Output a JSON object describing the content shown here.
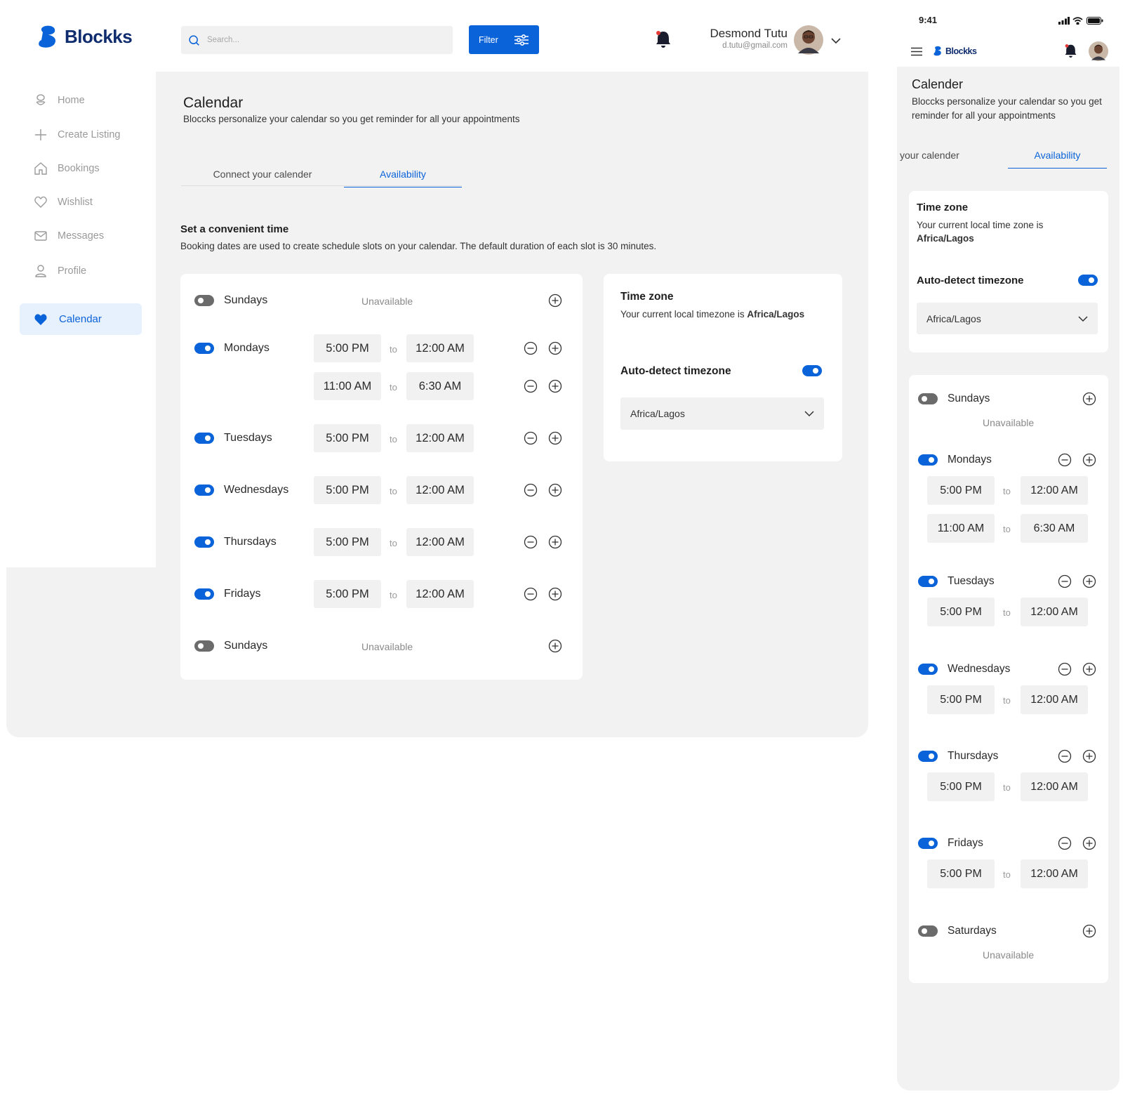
{
  "brand": {
    "name": "Blockks",
    "accent": "#0a63d8",
    "logo_color": "#0f2d6e"
  },
  "sidebar": {
    "items": [
      {
        "label": "Home",
        "icon": "home-icon"
      },
      {
        "label": "Create Listing",
        "icon": "plus-icon"
      },
      {
        "label": "Bookings",
        "icon": "house-icon"
      },
      {
        "label": "Wishlist",
        "icon": "heart-outline-icon"
      },
      {
        "label": "Messages",
        "icon": "mail-icon"
      },
      {
        "label": "Profile",
        "icon": "user-icon"
      },
      {
        "label": "Calendar",
        "icon": "heart-filled-icon",
        "active": true
      }
    ]
  },
  "header": {
    "search_placeholder": "Search...",
    "filter_label": "Filter",
    "user_name": "Desmond Tutu",
    "user_email": "d.tutu@gmail.com"
  },
  "page": {
    "title": "Calendar",
    "subtitle": "Bloccks personalize your calendar so you get reminder for all your appointments",
    "tabs": [
      "Connect your calender",
      "Availability"
    ],
    "active_tab": "Availability",
    "section_title": "Set a convenient time",
    "section_desc": "Booking dates are used to create schedule slots on your calendar. The default duration of each slot is 30 minutes."
  },
  "schedule": {
    "to_label": "to",
    "unavailable_label": "Unavailable",
    "days": [
      {
        "name": "Sundays",
        "enabled": false,
        "slots": []
      },
      {
        "name": "Mondays",
        "enabled": true,
        "slots": [
          [
            "5:00 PM",
            "12:00 AM"
          ],
          [
            "11:00 AM",
            "6:30 AM"
          ]
        ]
      },
      {
        "name": "Tuesdays",
        "enabled": true,
        "slots": [
          [
            "5:00 PM",
            "12:00 AM"
          ]
        ]
      },
      {
        "name": "Wednesdays",
        "enabled": true,
        "slots": [
          [
            "5:00 PM",
            "12:00 AM"
          ]
        ]
      },
      {
        "name": "Thursdays",
        "enabled": true,
        "slots": [
          [
            "5:00 PM",
            "12:00 AM"
          ]
        ]
      },
      {
        "name": "Fridays",
        "enabled": true,
        "slots": [
          [
            "5:00 PM",
            "12:00 AM"
          ]
        ]
      },
      {
        "name": "Sundays",
        "enabled": false,
        "slots": []
      }
    ]
  },
  "timezone": {
    "title": "Time zone",
    "desc_prefix": "Your current local timezone is",
    "zone": "Africa/Lagos",
    "auto_detect_label": "Auto-detect timezone",
    "auto_detect": true,
    "selected": "Africa/Lagos"
  },
  "mobile": {
    "status_time": "9:41",
    "brand": "Blockks",
    "title": "Calender",
    "subtitle": "Bloccks personalize your calendar so you get reminder for all your appointments",
    "tabs": [
      "your calender",
      "Availability"
    ],
    "tz_title": "Time zone",
    "tz_desc": "Your current local time zone is",
    "tz_zone": "Africa/Lagos",
    "auto_detect_label": "Auto-detect timezone",
    "tz_selected": "Africa/Lagos",
    "days": [
      {
        "name": "Sundays",
        "enabled": false,
        "slots": []
      },
      {
        "name": "Mondays",
        "enabled": true,
        "slots": [
          [
            "5:00 PM",
            "12:00 AM"
          ],
          [
            "11:00 AM",
            "6:30 AM"
          ]
        ]
      },
      {
        "name": "Tuesdays",
        "enabled": true,
        "slots": [
          [
            "5:00 PM",
            "12:00 AM"
          ]
        ]
      },
      {
        "name": "Wednesdays",
        "enabled": true,
        "slots": [
          [
            "5:00 PM",
            "12:00 AM"
          ]
        ]
      },
      {
        "name": "Thursdays",
        "enabled": true,
        "slots": [
          [
            "5:00 PM",
            "12:00 AM"
          ]
        ]
      },
      {
        "name": "Fridays",
        "enabled": true,
        "slots": [
          [
            "5:00 PM",
            "12:00 AM"
          ]
        ]
      },
      {
        "name": "Saturdays",
        "enabled": false,
        "slots": []
      }
    ]
  }
}
